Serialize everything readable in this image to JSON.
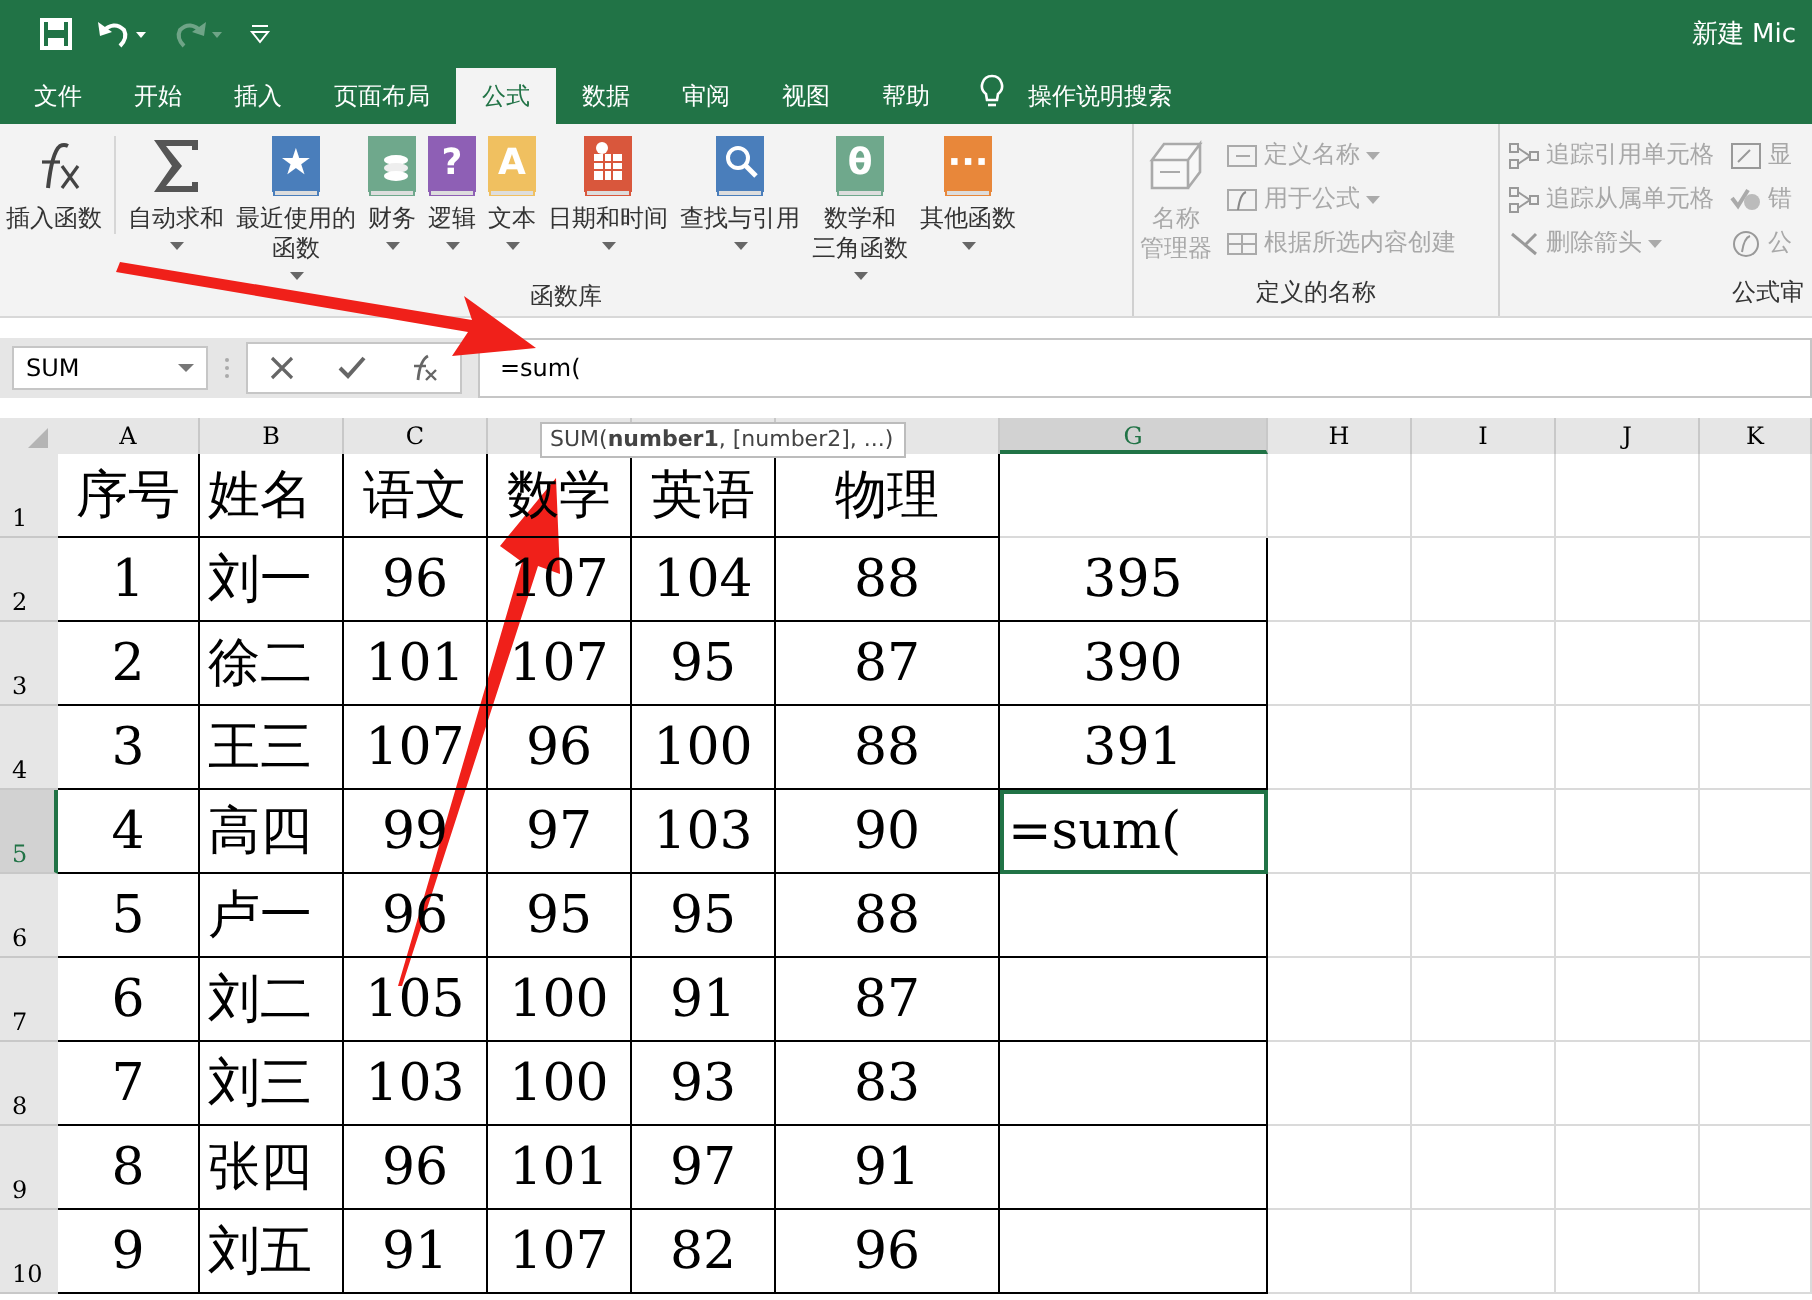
{
  "quick_access": [
    {
      "kind": "save",
      "disabled": false
    },
    {
      "kind": "undo",
      "disabled": false
    },
    {
      "kind": "redo",
      "disabled": true
    },
    {
      "kind": "customize",
      "disabled": false
    }
  ],
  "title_bar": {
    "title": "新建 Mic"
  },
  "tabs": [
    {
      "label": "文件",
      "selected": false
    },
    {
      "label": "开始",
      "selected": false
    },
    {
      "label": "插入",
      "selected": false
    },
    {
      "label": "页面布局",
      "selected": false
    },
    {
      "label": "公式",
      "selected": true
    },
    {
      "label": "数据",
      "selected": false
    },
    {
      "label": "审阅",
      "selected": false
    },
    {
      "label": "视图",
      "selected": false
    },
    {
      "label": "帮助",
      "selected": false
    }
  ],
  "tell_me": {
    "label": "操作说明搜索"
  },
  "function_library": {
    "label": "函数库",
    "buttons": [
      {
        "kind": "fx",
        "label": [
          "插入函数"
        ],
        "dropdown": false
      },
      {
        "kind": "sum",
        "label": [
          "自动求和"
        ],
        "dropdown": true
      },
      {
        "kind": "book",
        "color": "#4a7ebb",
        "glyph": "★",
        "label": [
          "最近使用的",
          "函数"
        ],
        "dropdown": true
      },
      {
        "kind": "coins",
        "color": "#6fa88c",
        "label": [
          "财务"
        ],
        "dropdown": true
      },
      {
        "kind": "book",
        "color": "#8e5fb5",
        "glyph": "?",
        "label": [
          "逻辑"
        ],
        "dropdown": true
      },
      {
        "kind": "book",
        "color": "#f0c060",
        "glyph": "A",
        "label": [
          "文本"
        ],
        "dropdown": true
      },
      {
        "kind": "calendar",
        "color": "#d9573c",
        "label": [
          "日期和时间"
        ],
        "dropdown": true
      },
      {
        "kind": "search",
        "color": "#4a7ebb",
        "label": [
          "查找与引用"
        ],
        "dropdown": true
      },
      {
        "kind": "book",
        "color": "#6fa88c",
        "glyph": "θ",
        "label": [
          "数学和",
          "三角函数"
        ],
        "dropdown": true
      },
      {
        "kind": "book",
        "color": "#e8873a",
        "glyph": "···",
        "label": [
          "其他函数"
        ],
        "dropdown": true
      }
    ]
  },
  "defined_names": {
    "label": "定义的名称",
    "manager": {
      "label": [
        "名称",
        "管理器"
      ],
      "disabled": true
    },
    "items": [
      {
        "kind": "tag",
        "label": "定义名称",
        "dropdown": true,
        "disabled": true
      },
      {
        "kind": "fx",
        "label": "用于公式",
        "dropdown": true,
        "disabled": true
      },
      {
        "kind": "grid",
        "label": "根据所选内容创建",
        "dropdown": false,
        "disabled": true
      }
    ]
  },
  "formula_auditing": {
    "label": "公式审",
    "items": [
      {
        "kind": "trace",
        "label": "追踪引用单元格",
        "dropdown": false,
        "disabled": true
      },
      {
        "kind": "trace",
        "label": "追踪从属单元格",
        "dropdown": false,
        "disabled": true
      },
      {
        "kind": "remove",
        "label": "删除箭头",
        "dropdown": true,
        "disabled": true
      }
    ],
    "more_items": [
      {
        "kind": "show",
        "label": "显",
        "disabled": true
      },
      {
        "kind": "error",
        "label": "错",
        "disabled": true
      },
      {
        "kind": "fx",
        "label": "公",
        "disabled": true
      }
    ]
  },
  "formula_bar": {
    "name_box": "SUM",
    "formula": "=sum("
  },
  "tooltip": {
    "text": "SUM(**number1**, [number2], ...)"
  },
  "columns": [
    {
      "label": "A",
      "selected": false
    },
    {
      "label": "B",
      "selected": false
    },
    {
      "label": "C",
      "selected": false
    },
    {
      "selected": false
    },
    {
      "selected": false
    },
    {
      "selected": false
    },
    {
      "label": "G",
      "selected": true
    },
    {
      "label": "H",
      "selected": false
    },
    {
      "label": "I",
      "selected": false
    },
    {
      "label": "J",
      "selected": false
    },
    {
      "label": "K",
      "selected": false
    }
  ],
  "rows": [
    {
      "label": "1",
      "selected": false,
      "cells": [
        "序号",
        "姓名",
        "语文",
        "数学",
        "英语",
        "物理",
        ""
      ]
    },
    {
      "label": "2",
      "selected": false,
      "cells": [
        "1",
        "刘一",
        "96",
        "107",
        "104",
        "88",
        "395"
      ]
    },
    {
      "label": "3",
      "selected": false,
      "cells": [
        "2",
        "徐二",
        "101",
        "107",
        "95",
        "87",
        "390"
      ]
    },
    {
      "label": "4",
      "selected": false,
      "cells": [
        "3",
        "王三",
        "107",
        "96",
        "100",
        "88",
        "391"
      ]
    },
    {
      "label": "5",
      "selected": true,
      "cells": [
        "4",
        "高四",
        "99",
        "97",
        "103",
        "90",
        "=sum("
      ]
    },
    {
      "label": "6",
      "selected": false,
      "cells": [
        "5",
        "卢一",
        "96",
        "95",
        "95",
        "88",
        ""
      ]
    },
    {
      "label": "7",
      "selected": false,
      "cells": [
        "6",
        "刘二",
        "105",
        "100",
        "91",
        "87",
        ""
      ]
    },
    {
      "label": "8",
      "selected": false,
      "cells": [
        "7",
        "刘三",
        "103",
        "100",
        "93",
        "83",
        ""
      ]
    },
    {
      "label": "9",
      "selected": false,
      "cells": [
        "8",
        "张四",
        "96",
        "101",
        "97",
        "91",
        ""
      ]
    },
    {
      "label": "10",
      "selected": false,
      "cells": [
        "9",
        "刘五",
        "91",
        "107",
        "82",
        "96",
        ""
      ]
    }
  ]
}
